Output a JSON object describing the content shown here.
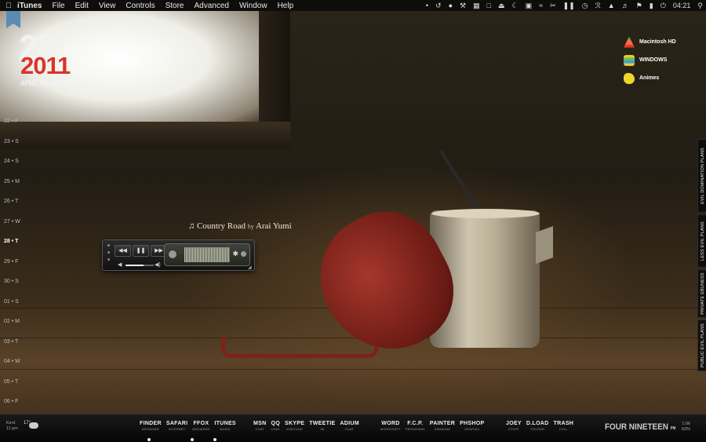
{
  "menubar": {
    "app": "iTunes",
    "items": [
      "File",
      "Edit",
      "View",
      "Controls",
      "Store",
      "Advanced",
      "Window",
      "Help"
    ],
    "clock": "04:21"
  },
  "date_widget": {
    "day": "28",
    "year": "2011",
    "text": "APRIL THURSDAY"
  },
  "calendar": [
    {
      "day": "22",
      "wd": "F"
    },
    {
      "day": "23",
      "wd": "S"
    },
    {
      "day": "24",
      "wd": "S"
    },
    {
      "day": "25",
      "wd": "M"
    },
    {
      "day": "26",
      "wd": "T"
    },
    {
      "day": "27",
      "wd": "W"
    },
    {
      "day": "28",
      "wd": "T"
    },
    {
      "day": "29",
      "wd": "F"
    },
    {
      "day": "30",
      "wd": "S"
    },
    {
      "day": "01",
      "wd": "S"
    },
    {
      "day": "02",
      "wd": "M"
    },
    {
      "day": "03",
      "wd": "T"
    },
    {
      "day": "04",
      "wd": "W"
    },
    {
      "day": "05",
      "wd": "T"
    },
    {
      "day": "06",
      "wd": "F"
    }
  ],
  "drives": [
    {
      "label": "Macintosh HD",
      "icon": "watermelon-drive-icon"
    },
    {
      "label": "WINDOWS",
      "icon": "windows-drive-icon"
    },
    {
      "label": "Animes",
      "icon": "banana-drive-icon"
    }
  ],
  "side_tabs": [
    "EVIL DOMINATION PLANS",
    "LESS EVIL PLANS",
    "PRIVATE EBUNESS",
    "PUBLIC EVIL PLANS"
  ],
  "now_playing": {
    "song": "Country Road",
    "by": "by",
    "artist": "Arai Yumi",
    "volume": 0.65
  },
  "weather": {
    "city": "Kent",
    "time": "11 pm",
    "temp": "17°"
  },
  "dock": {
    "group1": [
      {
        "title": "FINDER",
        "sub": "BROWSER"
      },
      {
        "title": "SAFARI",
        "sub": "INTERNET"
      },
      {
        "title": "FFOX",
        "sub": "BROWSER"
      },
      {
        "title": "ITUNES",
        "sub": "MUSIC"
      }
    ],
    "group2": [
      {
        "title": "MSN",
        "sub": "CHAT"
      },
      {
        "title": "QQ",
        "sub": "CHAT"
      },
      {
        "title": "SKYPE",
        "sub": "VOIPCHAT"
      },
      {
        "title": "TWEETIE",
        "sub": "IM"
      },
      {
        "title": "ADIUM",
        "sub": "CHAT"
      }
    ],
    "group3": [
      {
        "title": "WORD",
        "sub": "MICROSOFT"
      },
      {
        "title": "F.C.P.",
        "sub": "PROGRAMS"
      },
      {
        "title": "PAINTER",
        "sub": "DRAWING"
      },
      {
        "title": "PHSHOP",
        "sub": "GRAPHIC"
      }
    ],
    "group4": [
      {
        "title": "JOEY",
        "sub": "STUFF"
      },
      {
        "title": "D.LOAD",
        "sub": "FOLDER"
      },
      {
        "title": "TRASH",
        "sub": "FULL"
      }
    ]
  },
  "clock_word": {
    "text": "FOUR NINETEEN",
    "ampm": "PM"
  },
  "battery": {
    "time": "1:06",
    "pct": "63%"
  }
}
